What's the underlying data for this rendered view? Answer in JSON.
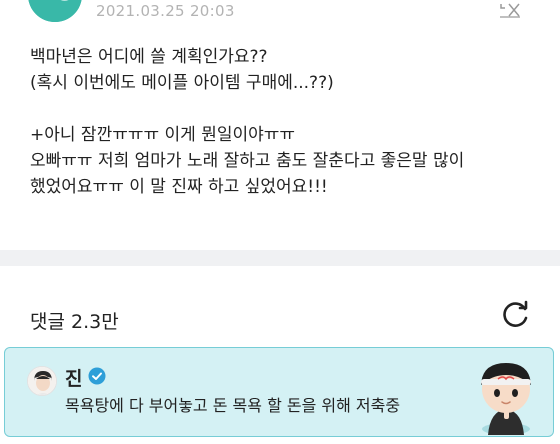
{
  "post": {
    "timestamp": "2021.03.25 20:03",
    "lines": [
      "백마년은 어디에 쓸 계획인가요??",
      "(혹시 이번에도 메이플 아이템 구매에...??)",
      "",
      "+아니 잠깐ㅠㅠㅠ 이게 뭔일이야ㅠㅠ",
      "오빠ㅠㅠ 저희 엄마가 노래 잘하고 춤도 잘춘다고 좋은말 많이",
      "했었어요ㅠㅠ 이 말 진짜 하고 싶었어요!!!"
    ]
  },
  "comments": {
    "title": "댓글 2.3만"
  },
  "artist_comment": {
    "name": "진",
    "text": "목욕탕에 다 부어놓고 돈 목욕 할 돈을 위해 저축중"
  },
  "colors": {
    "accent": "#39b8a8",
    "comment_bg": "#d4f1f4",
    "comment_border": "#76cdd6",
    "verified": "#2e9fd8"
  }
}
